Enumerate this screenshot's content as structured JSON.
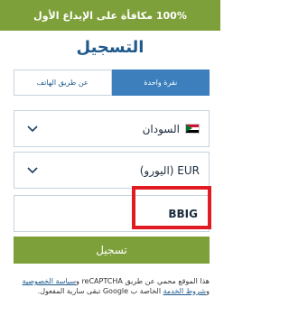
{
  "banner": {
    "text": "100% مكافأة على الإيداع الأول"
  },
  "title": "التسجيل",
  "tabs": [
    {
      "label": "عن طريق الهاتف",
      "active": false
    },
    {
      "label": "نقرة واحدة",
      "active": true
    }
  ],
  "country": {
    "value": "السودان",
    "icon": "sudan-flag-icon"
  },
  "currency": {
    "value": "EUR (اليورو)"
  },
  "promo": {
    "value": "BBIG"
  },
  "submit": {
    "label": "تسجيل"
  },
  "footer": {
    "text1": "هذا الموقع محمي عن طريق reCAPTCHA و",
    "privacy_link": "سياسة الخصوصية",
    "text2": " و",
    "terms_link": "شروط الخدمة",
    "text3": " الخاصة ب Google تبقى سارية المفعول."
  },
  "colors": {
    "brand_green": "#7ea03a",
    "brand_blue": "#1f5a8c",
    "tab_active": "#3c7fbc",
    "highlight": "#e11b22"
  }
}
